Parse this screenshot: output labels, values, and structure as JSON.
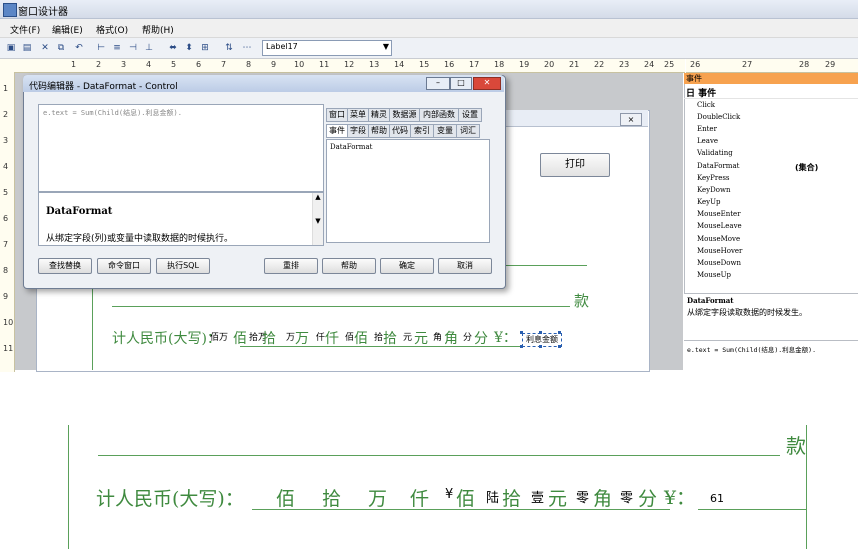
{
  "window": {
    "title": "窗口设计器"
  },
  "menu": [
    "文件(F)",
    "编辑(E)",
    "格式(O)",
    "帮助(H)"
  ],
  "toolbar": {
    "combo_value": "Label17"
  },
  "ruler_top": [
    "1",
    "2",
    "3",
    "4",
    "5",
    "6",
    "7",
    "8",
    "9",
    "10",
    "11",
    "12",
    "13",
    "14",
    "15",
    "16",
    "17",
    "18",
    "19",
    "20",
    "21",
    "22",
    "23",
    "24",
    "25",
    "26",
    "27",
    "28",
    "29"
  ],
  "ruler_left": [
    "1",
    "2",
    "3",
    "4",
    "5",
    "6",
    "7",
    "8",
    "9",
    "10",
    "11"
  ],
  "form": {
    "print_label": "打印",
    "close_label": "⨯",
    "kuan": "款",
    "daxie_label": "计人民币(大写)：",
    "selected_label": "利息金额"
  },
  "form_units": [
    {
      "small": "佰万",
      "big": "佰"
    },
    {
      "small": "拾万",
      "big": "拾"
    },
    {
      "small": "万",
      "big": "万"
    },
    {
      "small": "仟",
      "big": "仟"
    },
    {
      "small": "佰",
      "big": "佰"
    },
    {
      "small": "拾",
      "big": "拾"
    },
    {
      "small": "元",
      "big": "元"
    },
    {
      "small": "角",
      "big": "角"
    },
    {
      "small": "分",
      "big": "分"
    }
  ],
  "form_yen": "¥：",
  "dialog": {
    "title": "代码编辑器 - DataFormat - Control",
    "code": "e.text = Sum(Child(结息).利息金额).",
    "help_title": "DataFormat",
    "help_desc": "从绑定字段(列)或变量中读取数据的时候执行。",
    "tabs_row1": [
      "窗口",
      "菜单",
      "精灵",
      "数据源",
      "内部函数",
      "设置"
    ],
    "tabs_row2": [
      "事件",
      "字段",
      "帮助",
      "代码",
      "索引",
      "变量",
      "词汇"
    ],
    "list_items": [
      "DataFormat"
    ],
    "buttons": [
      "查找替换",
      "命令窗口",
      "执行SQL",
      "重排",
      "帮助",
      "确定",
      "取消"
    ]
  },
  "panel": {
    "header": "事件",
    "group": "日 事件",
    "events": [
      "Click",
      "DoubleClick",
      "Enter",
      "Leave",
      "Validating",
      "DataFormat",
      "KeyPress",
      "KeyDown",
      "KeyUp",
      "MouseEnter",
      "MouseLeave",
      "MouseMove",
      "MouseHover",
      "MouseDown",
      "MouseUp"
    ],
    "dataformat_value": "(集合)",
    "desc_title": "DataFormat",
    "desc": "从绑定字段读取数据的时候发生。",
    "code": "e.text = Sum(Child(结息).利息金额)."
  },
  "preview": {
    "kuan": "款",
    "daxie_label": "计人民币(大写)：",
    "units": [
      {
        "value": "",
        "label": "佰"
      },
      {
        "value": "",
        "label": "拾"
      },
      {
        "value": "",
        "label": "万"
      },
      {
        "value": "",
        "label": "仟"
      },
      {
        "value": "¥",
        "label": "佰"
      },
      {
        "value": "陆",
        "label": "拾"
      },
      {
        "value": "壹",
        "label": "元"
      },
      {
        "value": "零",
        "label": "角"
      },
      {
        "value": "零",
        "label": "分"
      }
    ],
    "yen": "¥：",
    "amount": "61"
  }
}
